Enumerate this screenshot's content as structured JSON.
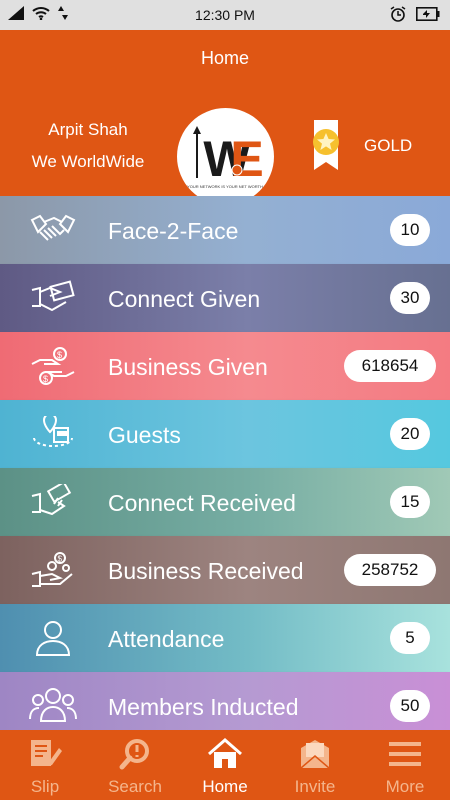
{
  "status_bar": {
    "time": "12:30 PM"
  },
  "header": {
    "title": "Home",
    "user_name": "Arpit Shah",
    "org_name": "We WorldWide",
    "tier": "GOLD",
    "logo_text": "WE",
    "logo_tagline": "YOUR NETWORK IS YOUR NET WORTH"
  },
  "menu": [
    {
      "label": "Face-2-Face",
      "count": "10",
      "icon": "handshake-icon",
      "color": "#8aa9d8"
    },
    {
      "label": "Connect Given",
      "count": "30",
      "icon": "connect-give-icon",
      "color": "#6b6e9a"
    },
    {
      "label": "Business Given",
      "count": "618654",
      "icon": "money-give-icon",
      "color": "#f27d83"
    },
    {
      "label": "Guests",
      "count": "20",
      "icon": "location-building-icon",
      "color": "#5ccbe0"
    },
    {
      "label": "Connect Received",
      "count": "15",
      "icon": "connect-receive-icon",
      "color": "#69a49a"
    },
    {
      "label": "Business Received",
      "count": "258752",
      "icon": "money-receive-icon",
      "color": "#8f7771"
    },
    {
      "label": "Attendance",
      "count": "5",
      "icon": "person-icon",
      "color": "#68b8c4"
    },
    {
      "label": "Members Inducted",
      "count": "50",
      "icon": "group-icon",
      "color": "#c98fd6"
    }
  ],
  "nav": [
    {
      "label": "Slip",
      "icon": "slip-icon",
      "active": false
    },
    {
      "label": "Search",
      "icon": "search-icon",
      "active": false
    },
    {
      "label": "Home",
      "icon": "home-icon",
      "active": true
    },
    {
      "label": "Invite",
      "icon": "invite-icon",
      "active": false
    },
    {
      "label": "More",
      "icon": "menu-icon",
      "active": false
    }
  ],
  "colors": {
    "brand": "#df5614",
    "nav_inactive": "#f4b58c"
  }
}
